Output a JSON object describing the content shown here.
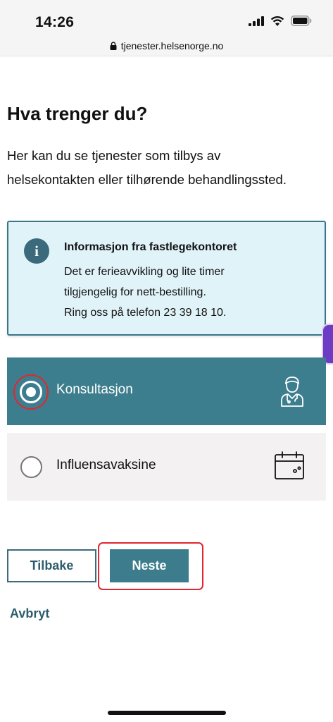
{
  "status_bar": {
    "time": "14:26"
  },
  "browser": {
    "url": "tjenester.helsenorge.no"
  },
  "page": {
    "title": "Hva trenger du?",
    "intro_line1": "Her kan du se tjenester som tilbys av",
    "intro_line2": "helsekontakten eller tilhørende behandlingssted."
  },
  "info_box": {
    "icon_char": "i",
    "title": "Informasjon fra fastlegekontoret",
    "line1": "Det er ferieavvikling og lite timer",
    "line2": "tilgjengelig for nett-bestilling.",
    "line3": "Ring oss på telefon 23 39 18 10."
  },
  "options": [
    {
      "label": "Konsultasjon",
      "selected": true,
      "icon": "doctor-icon"
    },
    {
      "label": "Influensavaksine",
      "selected": false,
      "icon": "calendar-icon"
    }
  ],
  "buttons": {
    "back": "Tilbake",
    "next": "Neste",
    "cancel": "Avbryt"
  },
  "colors": {
    "primary": "#3d7e8e",
    "info_background": "#e0f3f8",
    "highlight": "#e0262f",
    "side_tab": "#6d3cc4"
  }
}
